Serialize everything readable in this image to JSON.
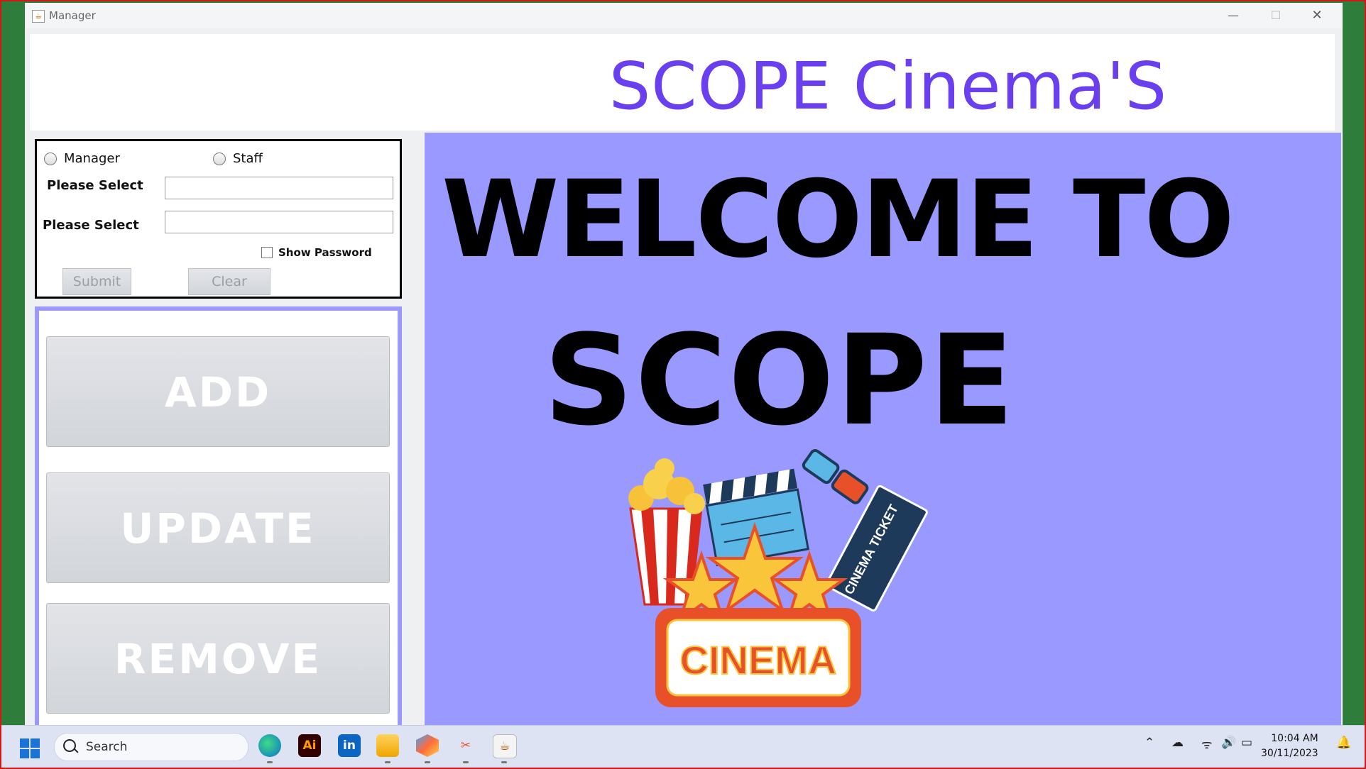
{
  "window": {
    "title": "Manager"
  },
  "header": {
    "app_title": "SCOPE Cinema'S"
  },
  "login": {
    "role_manager": "Manager",
    "role_staff": "Staff",
    "label_1": "Please Select",
    "label_2": "Please Select",
    "field_1_value": "",
    "field_2_value": "",
    "show_password_label": "Show Password",
    "submit_label": "Submit",
    "clear_label": "Clear"
  },
  "actions": {
    "add_label": "ADD",
    "update_label": "UPDATE",
    "remove_label": "REMOVE"
  },
  "welcome": {
    "line1": "WELCOME TO",
    "line2": "SCOPE",
    "art": {
      "sign_text": "CINEMA",
      "ticket_text": "CINEMA TICKET"
    }
  },
  "taskbar": {
    "search_placeholder": "Search",
    "pinned_apps": [
      "edge-icon",
      "illustrator-icon",
      "linkedin-icon",
      "file-explorer-icon",
      "app-icon",
      "snipping-tool-icon",
      "java-icon"
    ],
    "time": "10:04 AM",
    "date": "30/11/2023"
  },
  "colors": {
    "title_purple": "#6a3ff0",
    "welcome_bg": "#9999ff",
    "desktop_green": "#2f7d3a"
  }
}
